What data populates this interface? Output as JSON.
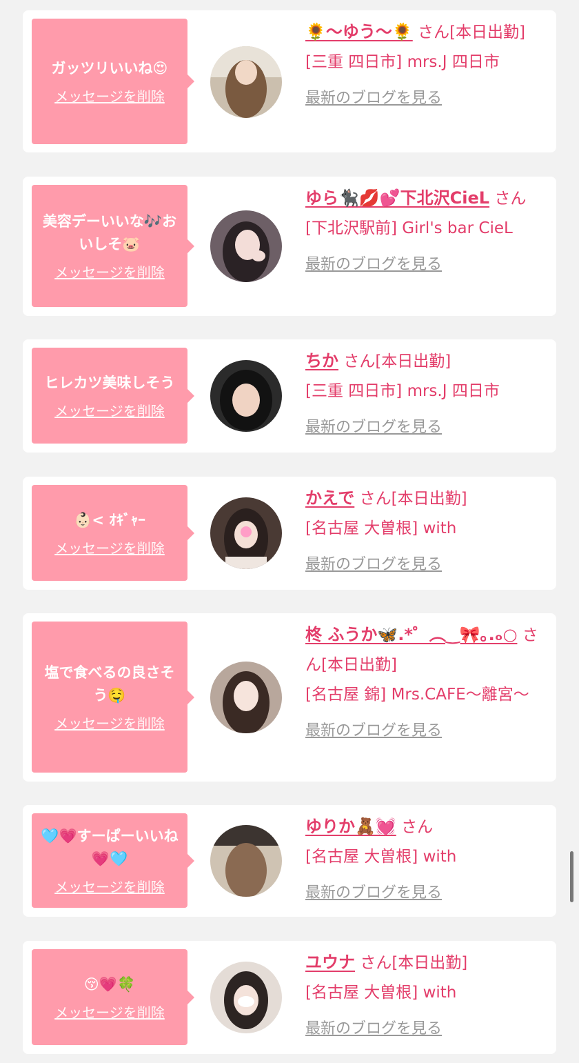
{
  "common": {
    "delete_label": "メッセージを削除",
    "blog_label": "最新のブログを見る"
  },
  "items": [
    {
      "message": "ガッツリいいね😍",
      "name": "🌻〜ゆう〜🌻",
      "suffix": "さん[本日出勤]",
      "shop": "[三重 四日市] mrs.J 四日市"
    },
    {
      "message": "美容デーいいな🎶おいしそ🐷",
      "name": "ゆら🐈‍⬛💋💕下北沢CieL",
      "suffix": "さん",
      "shop": "[下北沢駅前] Girl's bar CieL"
    },
    {
      "message": "ヒレカツ美味しそう",
      "name": "ちか",
      "suffix": "さん[本日出勤]",
      "shop": "[三重 四日市] mrs.J 四日市"
    },
    {
      "message": "👶🏻< ｵｷﾞｬｰ",
      "name": "かえで",
      "suffix": "さん[本日出勤]",
      "shop": "[名古屋 大曽根] with"
    },
    {
      "message": "塩で食べるの良さそう🤤",
      "name": "柊 ふうか🦋.*゜︵‿🎀｡.ₒ○",
      "suffix": "さん[本日出勤]",
      "shop": "[名古屋 錦] Mrs.CAFE〜離宮〜"
    },
    {
      "message": "🩵💗すーぱーいいね💗🩵",
      "name": "ゆりか🧸💓",
      "suffix": "さん",
      "shop": "[名古屋 大曽根] with"
    },
    {
      "message": "😚💗🍀",
      "name": "ユウナ",
      "suffix": "さん[本日出勤]",
      "shop": "[名古屋 大曽根] with"
    }
  ]
}
